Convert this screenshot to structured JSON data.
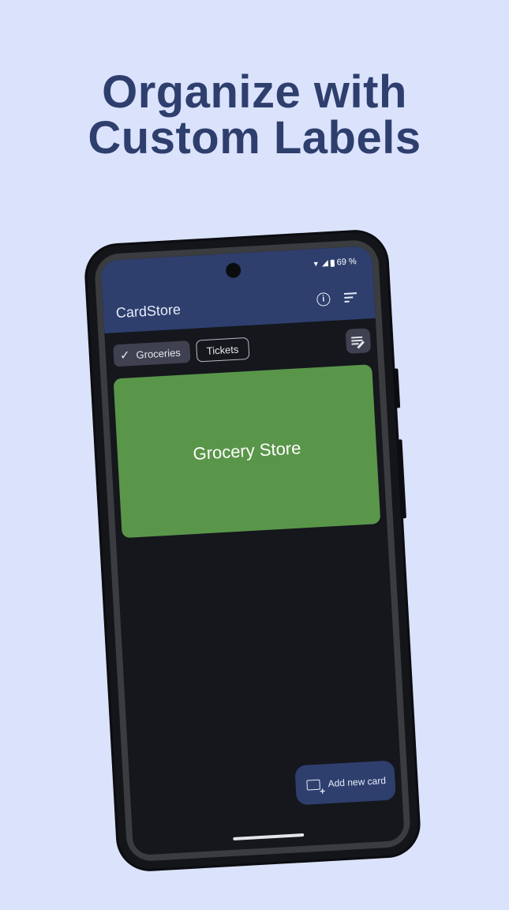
{
  "headline": {
    "line1": "Organize with",
    "line2": "Custom Labels"
  },
  "status_bar": {
    "battery": "69 %"
  },
  "app_bar": {
    "title": "CardStore",
    "info_icon": "info-icon",
    "sort_icon": "sort-icon"
  },
  "labels": {
    "chips": [
      {
        "label": "Groceries",
        "selected": true
      },
      {
        "label": "Tickets",
        "selected": false
      }
    ],
    "edit_icon": "edit-labels-icon"
  },
  "cards": [
    {
      "name": "Grocery Store",
      "color": "#5a964a"
    }
  ],
  "fab": {
    "label": "Add new card",
    "icon": "add-card-icon"
  },
  "colors": {
    "background": "#dbe2fb",
    "headline": "#2e3f6e",
    "app_bar": "#2e3f6e",
    "screen": "#15171c"
  }
}
